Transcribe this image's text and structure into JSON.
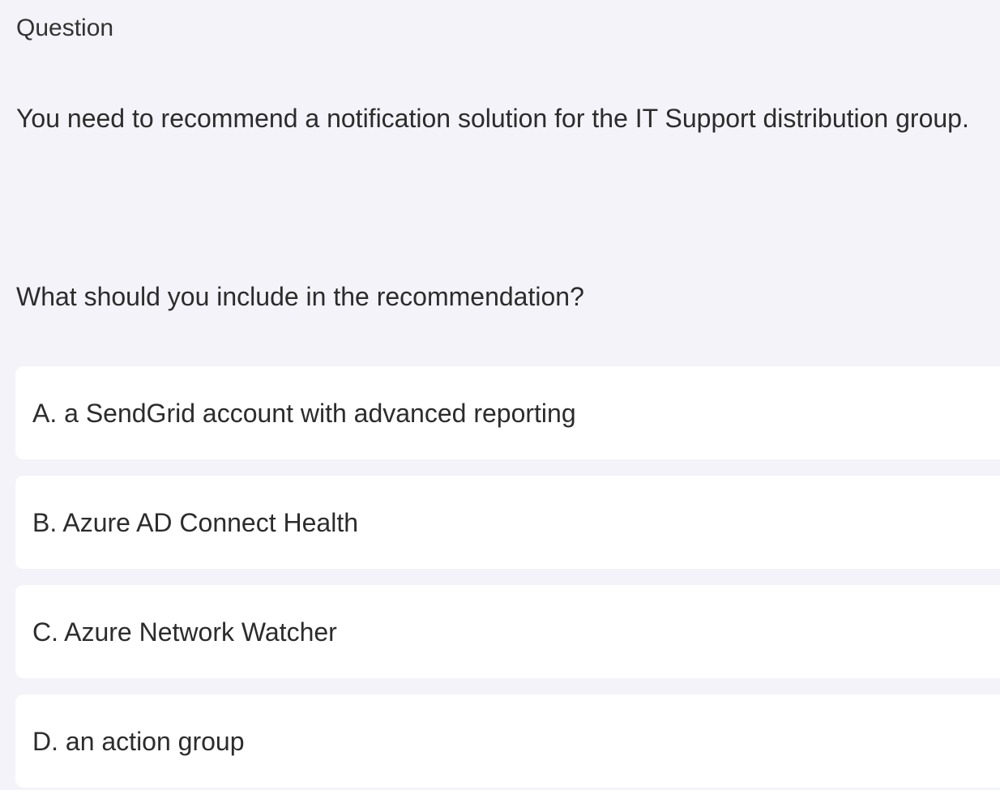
{
  "header": {
    "title": "Question"
  },
  "question": {
    "text": "You need to recommend a notification solution for the IT Support distribution group.",
    "prompt": "What should you include in the recommendation?"
  },
  "options": [
    {
      "label": "A. a SendGrid account with advanced reporting"
    },
    {
      "label": "B. Azure AD Connect Health"
    },
    {
      "label": "C. Azure Network Watcher"
    },
    {
      "label": "D. an action group"
    }
  ]
}
